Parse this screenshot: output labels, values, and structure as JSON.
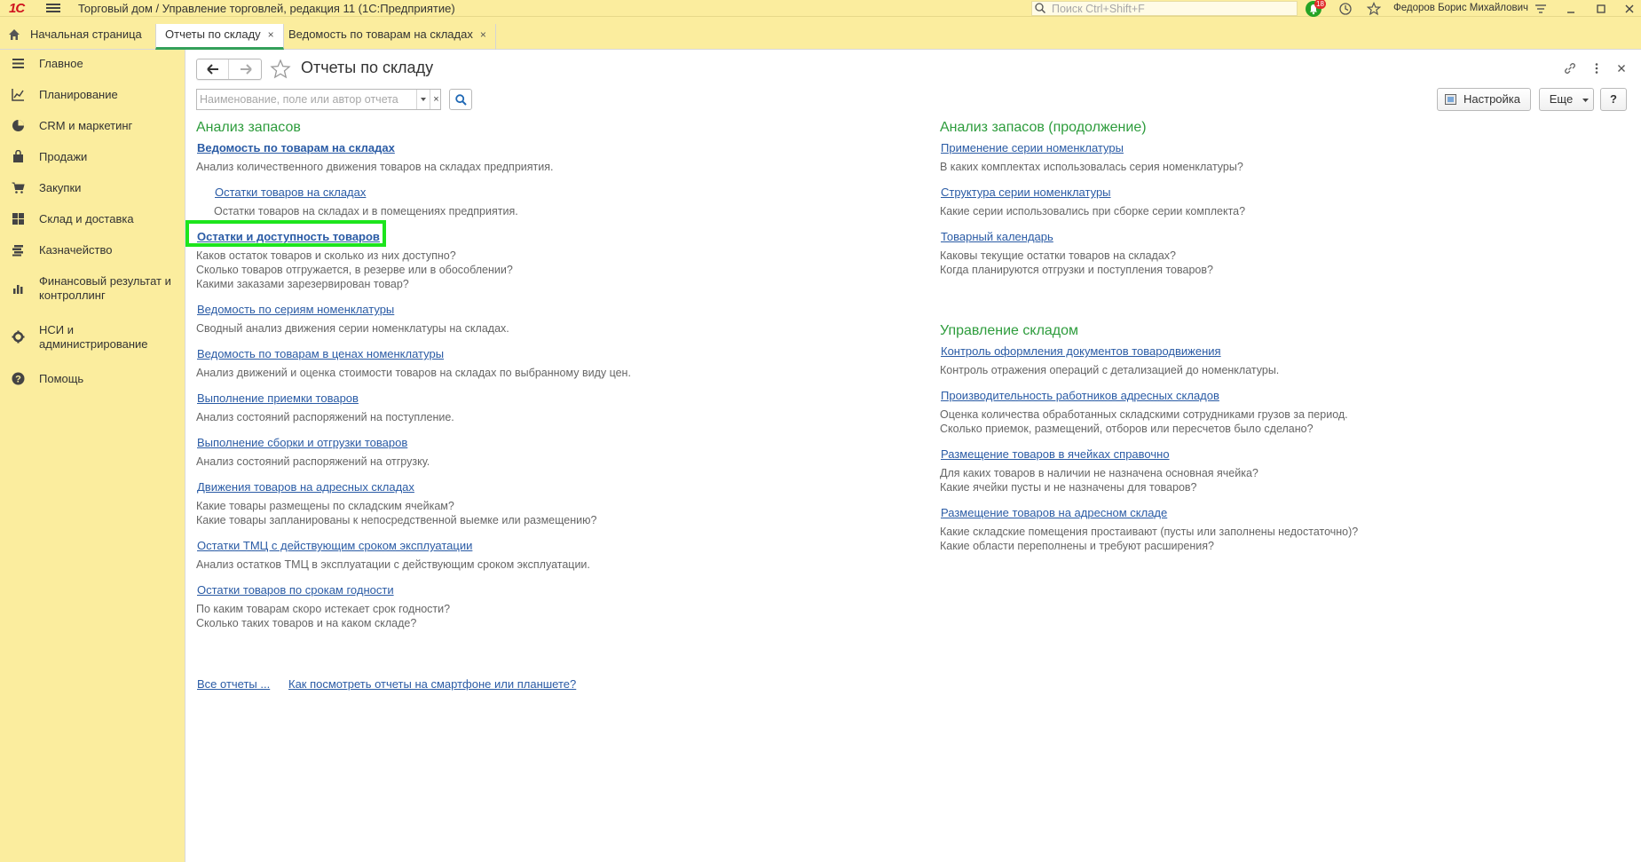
{
  "titlebar": {
    "logo": "1С",
    "app_title": "Торговый дом / Управление торговлей, редакция 11  (1С:Предприятие)",
    "search_placeholder": "Поиск Ctrl+Shift+F",
    "notifications_count": "18",
    "user_name": "Федоров Борис Михайлович"
  },
  "tabs": {
    "home": "Начальная страница",
    "active": "Отчеты по складу",
    "other": "Ведомость по товарам на складах",
    "close": "×"
  },
  "sidebar": {
    "items": [
      {
        "label": "Главное",
        "icon": "list-icon"
      },
      {
        "label": "Планирование",
        "icon": "planning-icon"
      },
      {
        "label": "CRM и маркетинг",
        "icon": "pie-chart-icon"
      },
      {
        "label": "Продажи",
        "icon": "bag-icon"
      },
      {
        "label": "Закупки",
        "icon": "cart-icon"
      },
      {
        "label": "Склад и доставка",
        "icon": "grid-icon"
      },
      {
        "label": "Казначейство",
        "icon": "coins-icon"
      },
      {
        "label": "Финансовый результат и контроллинг",
        "icon": "bar-chart-icon"
      },
      {
        "label": "НСИ и администрирование",
        "icon": "gear-icon"
      },
      {
        "label": "Помощь",
        "icon": "help-icon"
      }
    ]
  },
  "page": {
    "title": "Отчеты по складу",
    "filter_placeholder": "Наименование, поле или автор отчета",
    "clear": "×",
    "settings_button": "Настройка",
    "more_button": "Еще",
    "help_button": "?"
  },
  "left": {
    "heading": "Анализ запасов",
    "reports": [
      {
        "title": "Ведомость по товарам на складах",
        "desc": [
          "Анализ количественного движения товаров на складах предприятия."
        ]
      },
      {
        "title": "Остатки товаров на складах",
        "desc": [
          "Остатки товаров на складах и в помещениях предприятия."
        ]
      },
      {
        "title": "Остатки и доступность товаров",
        "desc": [
          "Каков остаток товаров и сколько из них доступно?",
          "Сколько товаров отгружается, в резерве или в обособлении?",
          "Какими заказами зарезервирован товар?"
        ]
      },
      {
        "title": "Ведомость по сериям номенклатуры",
        "desc": [
          "Сводный анализ движения серии номенклатуры на складах."
        ]
      },
      {
        "title": "Ведомость по товарам в ценах номенклатуры",
        "desc": [
          "Анализ движений и оценка стоимости товаров на складах по выбранному виду цен."
        ]
      },
      {
        "title": "Выполнение приемки товаров",
        "desc": [
          "Анализ состояний распоряжений на поступление."
        ]
      },
      {
        "title": "Выполнение сборки и отгрузки товаров",
        "desc": [
          "Анализ состояний распоряжений на отгрузку."
        ]
      },
      {
        "title": "Движения товаров на адресных складах",
        "desc": [
          "Какие товары размещены по складским ячейкам?",
          "Какие товары запланированы к непосредственной выемке или размещению?"
        ]
      },
      {
        "title": "Остатки ТМЦ с действующим сроком эксплуатации",
        "desc": [
          "Анализ остатков ТМЦ в эксплуатации с действующим сроком эксплуатации."
        ]
      },
      {
        "title": "Остатки товаров по срокам годности",
        "desc": [
          "По каким товарам скоро истекает срок годности?",
          "Сколько таких товаров и на каком складе?"
        ]
      }
    ]
  },
  "right": {
    "heading1": "Анализ запасов (продолжение)",
    "reports1": [
      {
        "title": "Применение серии номенклатуры",
        "desc": [
          "В каких комплектах использовалась серия номенклатуры?"
        ]
      },
      {
        "title": "Структура серии номенклатуры",
        "desc": [
          "Какие серии использовались при сборке серии комплекта?"
        ]
      },
      {
        "title": "Товарный календарь",
        "desc": [
          "Каковы текущие остатки товаров на складах?",
          "Когда планируются отгрузки и поступления товаров?"
        ]
      }
    ],
    "heading2": "Управление складом",
    "reports2": [
      {
        "title": "Контроль оформления документов товародвижения",
        "desc": [
          "Контроль отражения операций с детализацией до номенклатуры."
        ]
      },
      {
        "title": "Производительность работников адресных складов",
        "desc": [
          "Оценка количества обработанных складскими сотрудниками грузов за период.",
          "Сколько приемок, размещений, отборов или пересчетов было сделано?"
        ]
      },
      {
        "title": "Размещение товаров в ячейках справочно",
        "desc": [
          "Для каких товаров в наличии не назначена основная ячейка?",
          "Какие ячейки пусты и не назначены для товаров?"
        ]
      },
      {
        "title": "Размещение товаров на адресном складе",
        "desc": [
          "Какие складские помещения простаивают (пусты или заполнены недостаточно)?",
          "Какие области переполнены и требуют расширения?"
        ]
      }
    ]
  },
  "footer": {
    "all_reports": "Все отчеты ...",
    "mobile": "Как посмотреть отчеты на смартфоне или планшете?"
  }
}
